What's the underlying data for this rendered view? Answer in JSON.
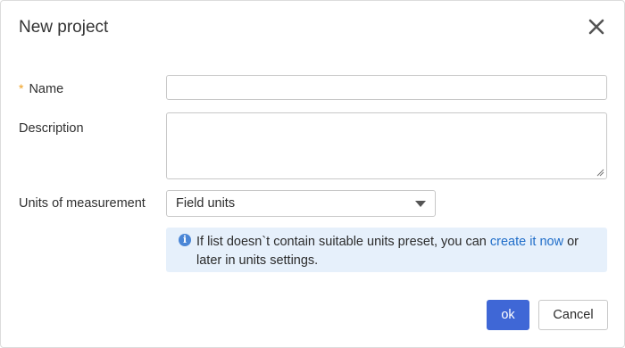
{
  "dialog": {
    "title": "New project",
    "close_icon": "close-icon"
  },
  "form": {
    "name": {
      "label": "Name",
      "required_marker": "*",
      "value": ""
    },
    "description": {
      "label": "Description",
      "value": ""
    },
    "units": {
      "label": "Units of measurement",
      "selected": "Field units"
    }
  },
  "info": {
    "icon": "info-icon",
    "text_before": "If list doesn`t contain suitable units preset, you can ",
    "link_text": "create it now",
    "text_after": " or later in units settings."
  },
  "buttons": {
    "ok_label": "ok",
    "cancel_label": "Cancel"
  },
  "colors": {
    "primary": "#3f67d6",
    "link": "#1f6dc9",
    "info_bg": "#e6f0fb",
    "required": "#f0a020"
  }
}
